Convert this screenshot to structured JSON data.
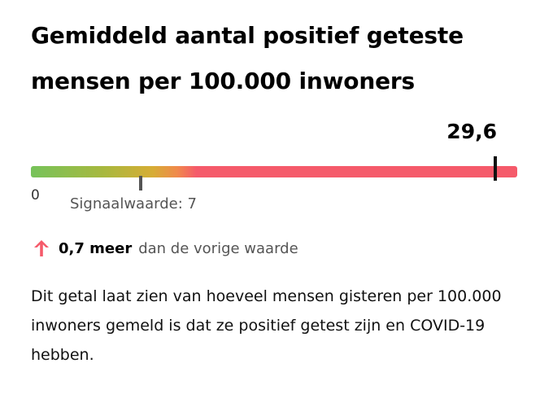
{
  "title": "Gemiddeld aantal positief geteste mensen per 100.000 inwoners",
  "gauge": {
    "current_label": "29,6",
    "current_value": 29.6,
    "max_value": 31,
    "signal_value": 7,
    "zero_label": "0",
    "signal_label": "Signaalwaarde: 7",
    "colors": {
      "low": "#76c35a",
      "mid": "#d6ad35",
      "high": "#f55a6a"
    }
  },
  "change": {
    "icon": "arrow-up-icon",
    "direction": "up",
    "amount_label": "0,7 meer",
    "rest_label": "dan de vorige waarde",
    "color": "#f55a6a"
  },
  "description": "Dit getal laat zien van hoeveel mensen gisteren per 100.000 inwoners gemeld is dat ze positief getest zijn en COVID-19 hebben."
}
